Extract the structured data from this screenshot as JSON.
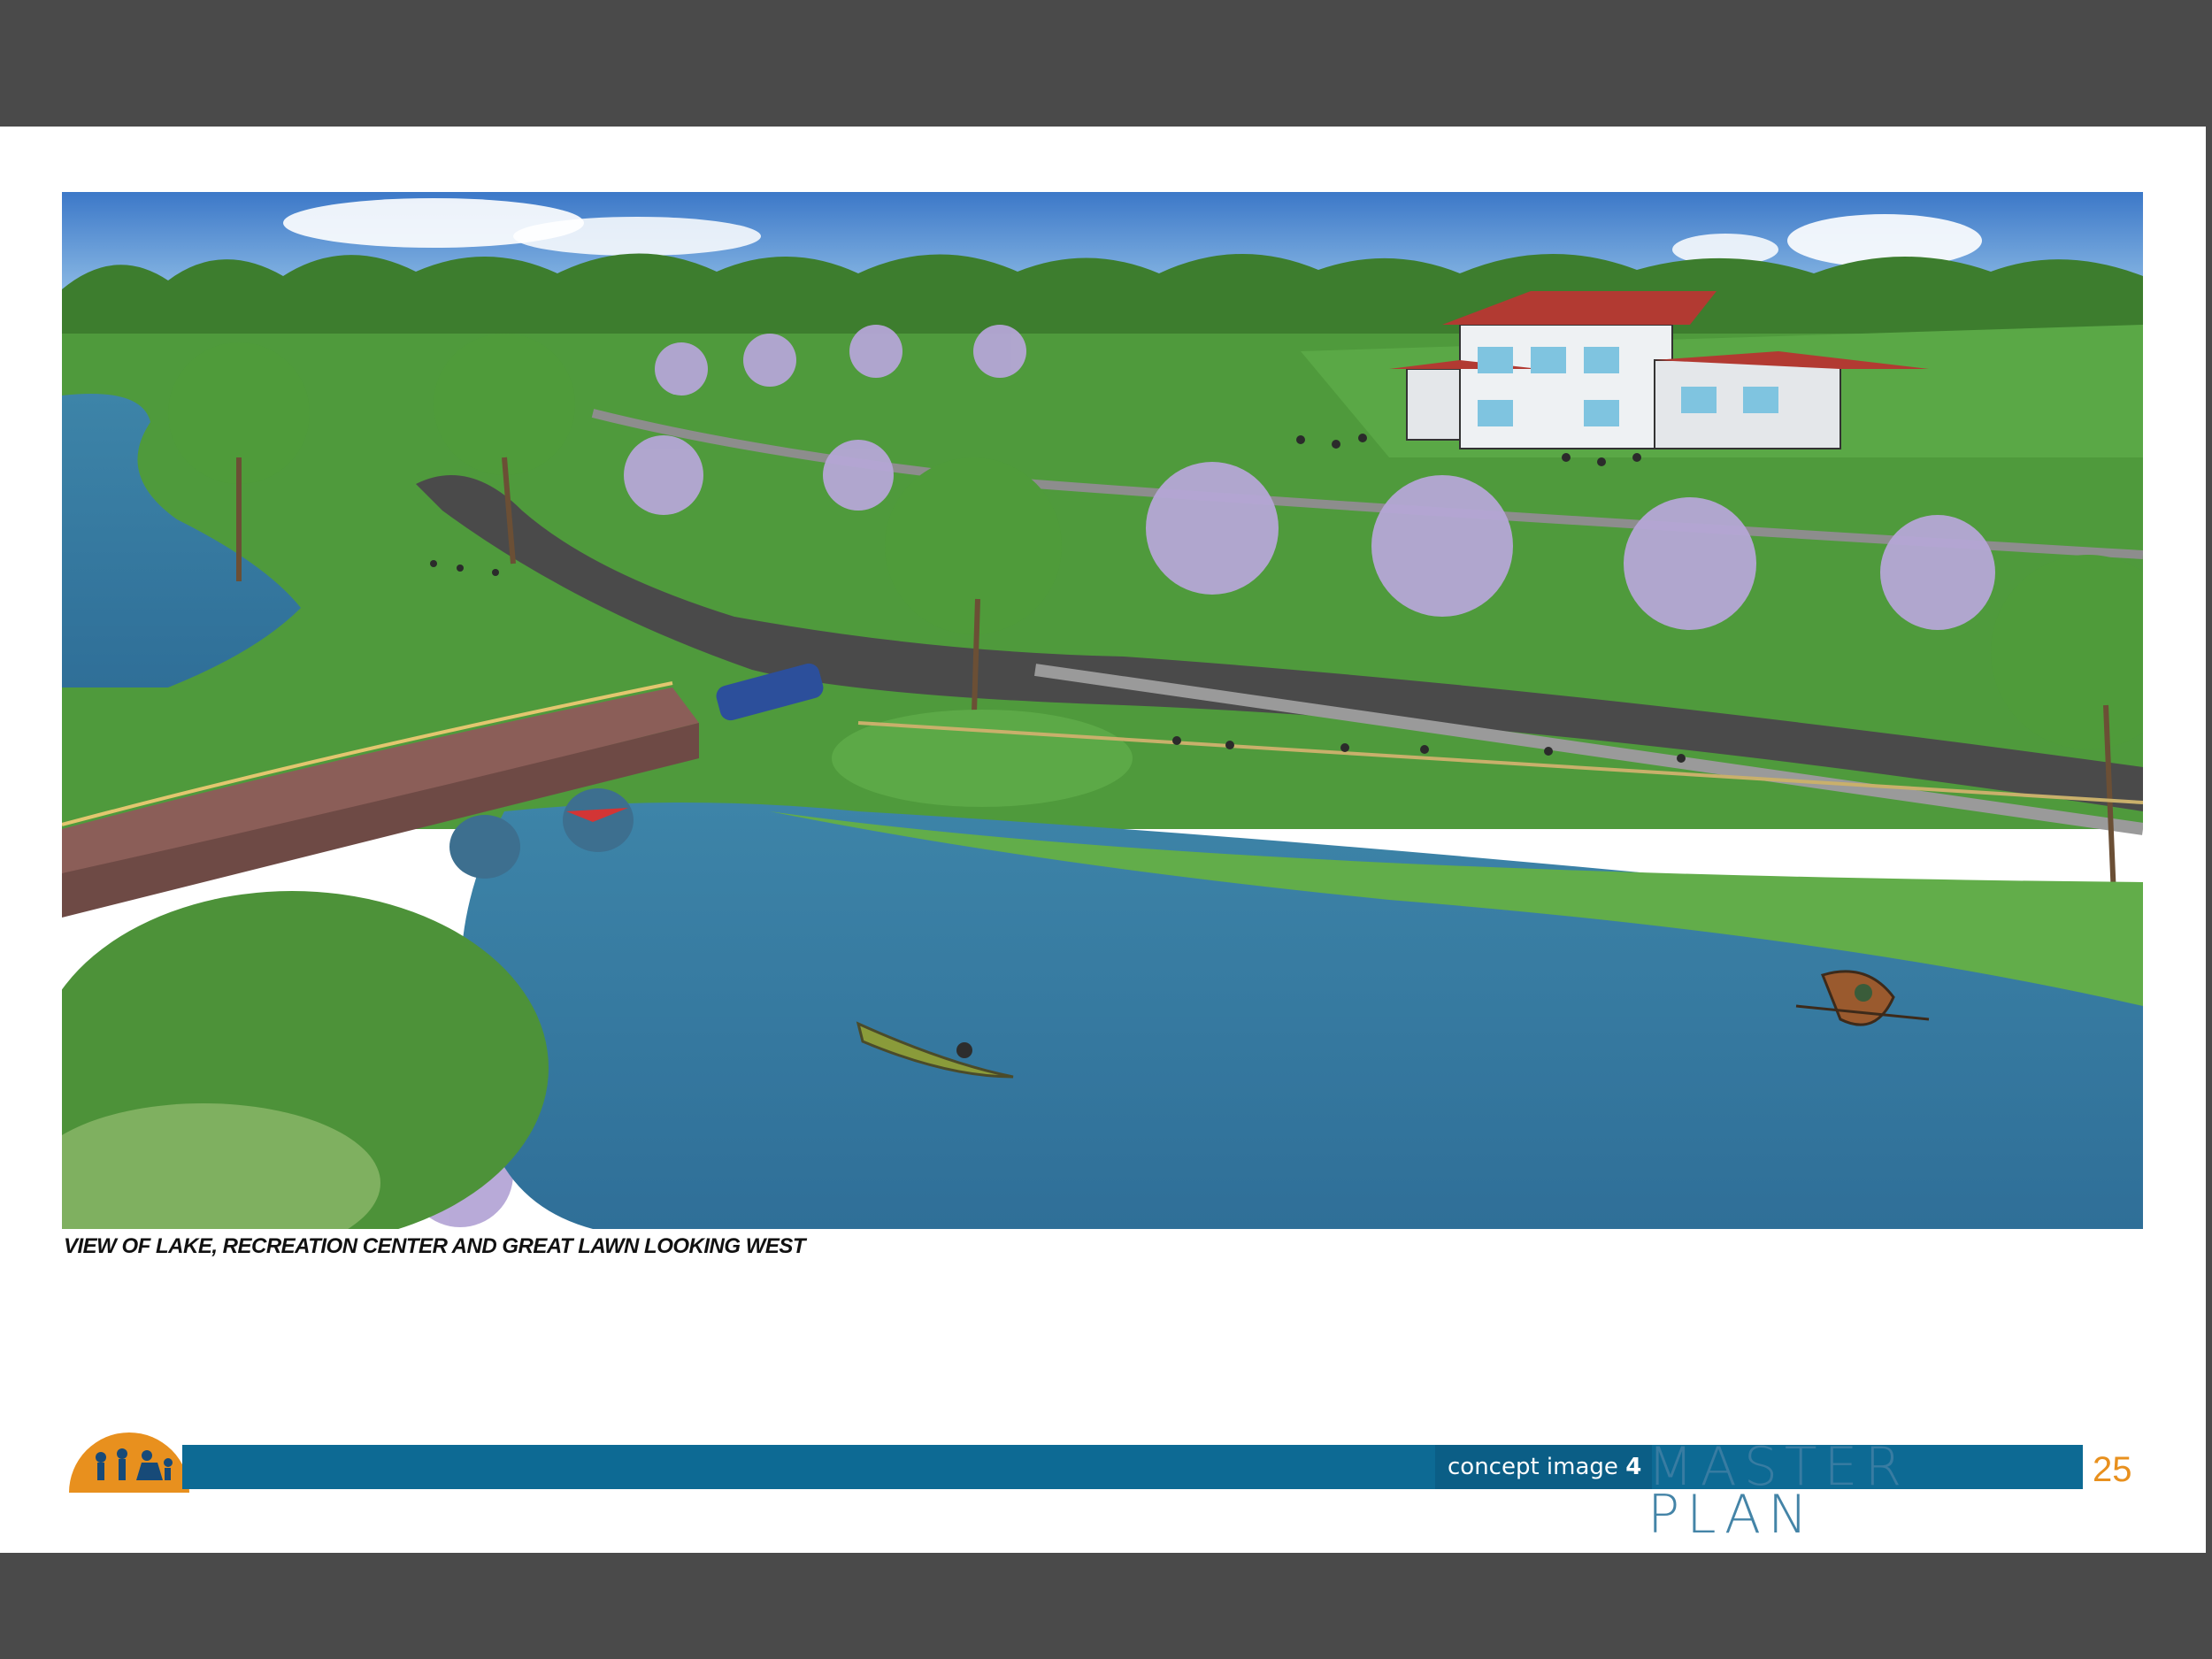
{
  "caption": "VIEW OF LAKE, RECREATION CENTER AND GREAT LAWN LOOKING WEST",
  "footer": {
    "concept_prefix": "concept image",
    "concept_number": "4",
    "title": "MASTER PLAN",
    "page_number": "25"
  },
  "icons": {
    "logo": "park-people-logo"
  },
  "colors": {
    "footer_band": "#0d6a94",
    "page_number": "#e8901e",
    "logo_orange": "#e8901e"
  }
}
